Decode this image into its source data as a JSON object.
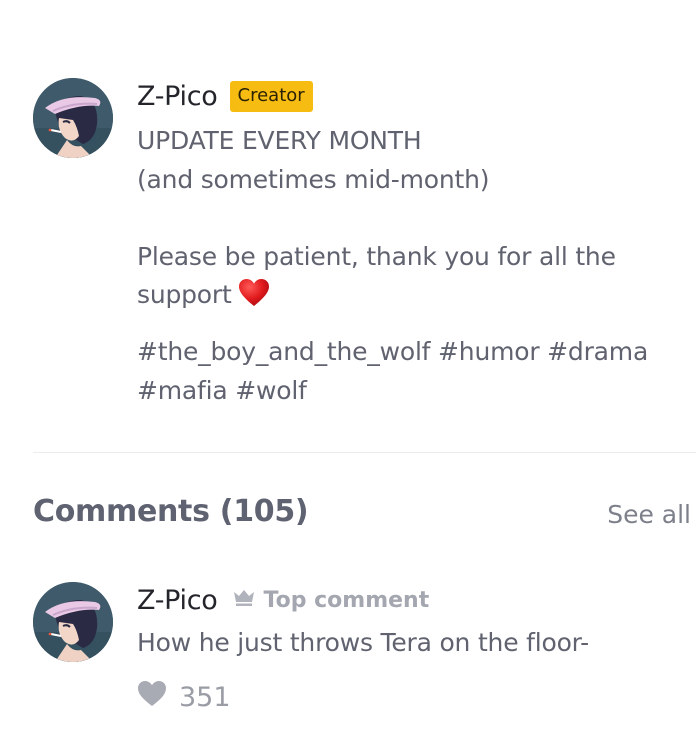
{
  "creator_note": {
    "author": "Z-Pico",
    "badge": "Creator",
    "lines": [
      "UPDATE EVERY MONTH",
      "(and sometimes mid-month)",
      "",
      "Please be patient, thank you for all the",
      "support"
    ],
    "emoji": "red-heart-icon",
    "tags": [
      "#the_boy_and_the_wolf",
      "#humor",
      "#drama",
      "#mafia",
      "#wolf"
    ]
  },
  "comments": {
    "title": "Comments (105)",
    "see_all": "See all",
    "items": [
      {
        "author": "Z-Pico",
        "label": "Top comment",
        "label_icon": "crown-icon",
        "text": "How he just throws Tera on the floor-",
        "likes": "351",
        "like_icon": "heart-icon"
      }
    ]
  },
  "colors": {
    "badge": "#f7bc12",
    "text": "#60636f",
    "title": "#24252b",
    "muted": "#a4a6b0",
    "emoji_heart": "#d7191f"
  }
}
